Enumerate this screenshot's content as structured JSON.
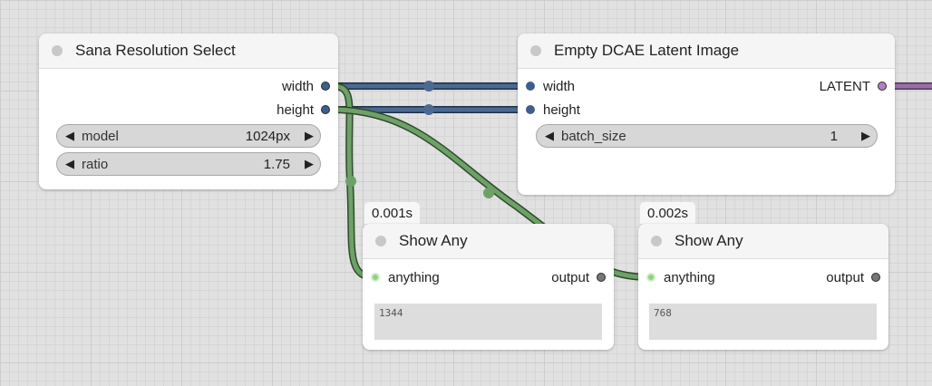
{
  "nodes": {
    "sana": {
      "title": "Sana Resolution Select",
      "outputs": [
        "width",
        "height"
      ],
      "widgets": [
        {
          "label": "model",
          "value": "1024px"
        },
        {
          "label": "ratio",
          "value": "1.75"
        }
      ]
    },
    "dcae": {
      "title": "Empty DCAE Latent Image",
      "inputs": [
        "width",
        "height"
      ],
      "output": "LATENT",
      "widgets": [
        {
          "label": "batch_size",
          "value": "1"
        }
      ]
    },
    "show1": {
      "timing": "0.001s",
      "title": "Show Any",
      "input": "anything",
      "output": "output",
      "text": "1344"
    },
    "show2": {
      "timing": "0.002s",
      "title": "Show Any",
      "input": "anything",
      "output": "output",
      "text": "768"
    }
  },
  "colors": {
    "int_link": "#3d5f8c",
    "any_link": "#6ea168",
    "latent_link": "#9b6fa8",
    "any_slot": "#8fd27f"
  },
  "glyphs": {
    "arrow_left": "◀",
    "arrow_right": "▶"
  }
}
